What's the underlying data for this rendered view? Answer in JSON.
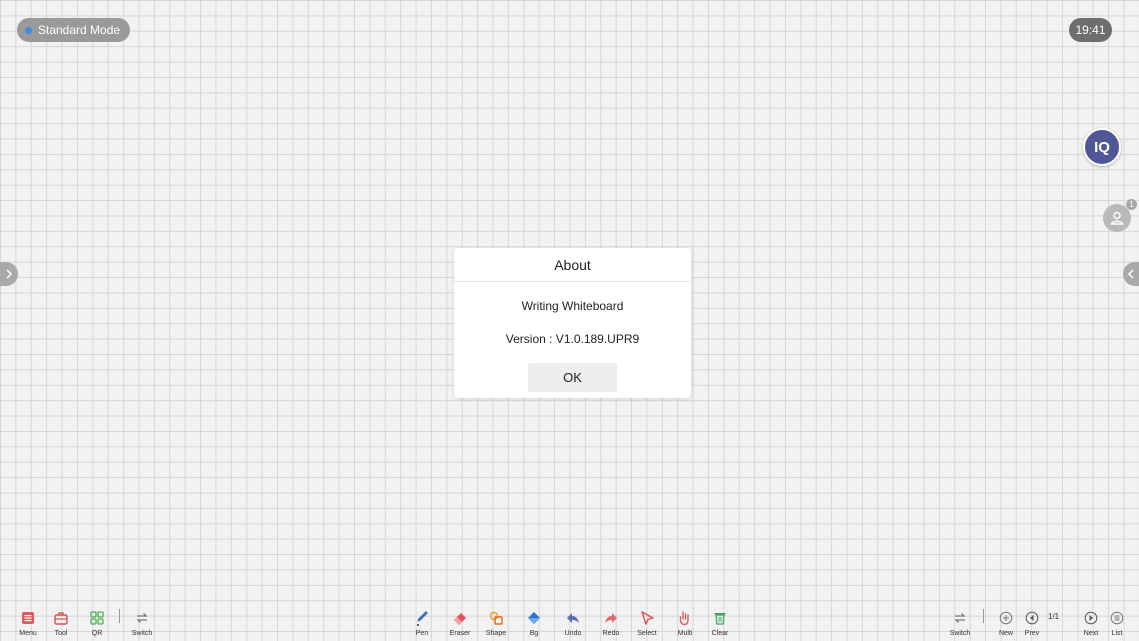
{
  "status": {
    "mode_label": "Standard Mode",
    "time": "19:41"
  },
  "side": {
    "iq_label": "IQ",
    "user_badge": "1"
  },
  "dialog": {
    "title": "About",
    "app_name": "Writing Whiteboard",
    "version": "Version : V1.0.189.UPR9",
    "ok_label": "OK"
  },
  "left_toolbar": [
    {
      "label": "Menu",
      "icon": "menu-icon",
      "color": "#e05a5a"
    },
    {
      "label": "Tool",
      "icon": "toolbox-icon",
      "color": "#d9534f"
    },
    {
      "label": "QR",
      "icon": "qr-grid-icon",
      "color": "#4caf50"
    },
    {
      "label": "Switch",
      "icon": "switch-icon",
      "color": "#777777"
    }
  ],
  "center_toolbar": [
    {
      "label": "Pen",
      "icon": "pen-icon",
      "color": "#3b6fb6"
    },
    {
      "label": "Eraser",
      "icon": "eraser-icon",
      "color": "#e0525a"
    },
    {
      "label": "Shape",
      "icon": "shape-icon",
      "color": "#f0a020"
    },
    {
      "label": "Bg",
      "icon": "paint-bucket-icon",
      "color": "#2f72c9"
    },
    {
      "label": "Undo",
      "icon": "undo-icon",
      "color": "#5a6fb0"
    },
    {
      "label": "Redo",
      "icon": "redo-icon",
      "color": "#e06a6a"
    },
    {
      "label": "Select",
      "icon": "select-arrow-icon",
      "color": "#d9534f"
    },
    {
      "label": "Multi",
      "icon": "multi-touch-icon",
      "color": "#e05a5a"
    },
    {
      "label": "Clear",
      "icon": "trash-icon",
      "color": "#3aa86a"
    }
  ],
  "right_toolbar": {
    "switch_label": "Switch",
    "new_label": "New",
    "prev_label": "Prev",
    "page_count": "1/1",
    "next_label": "Next",
    "list_label": "List"
  }
}
